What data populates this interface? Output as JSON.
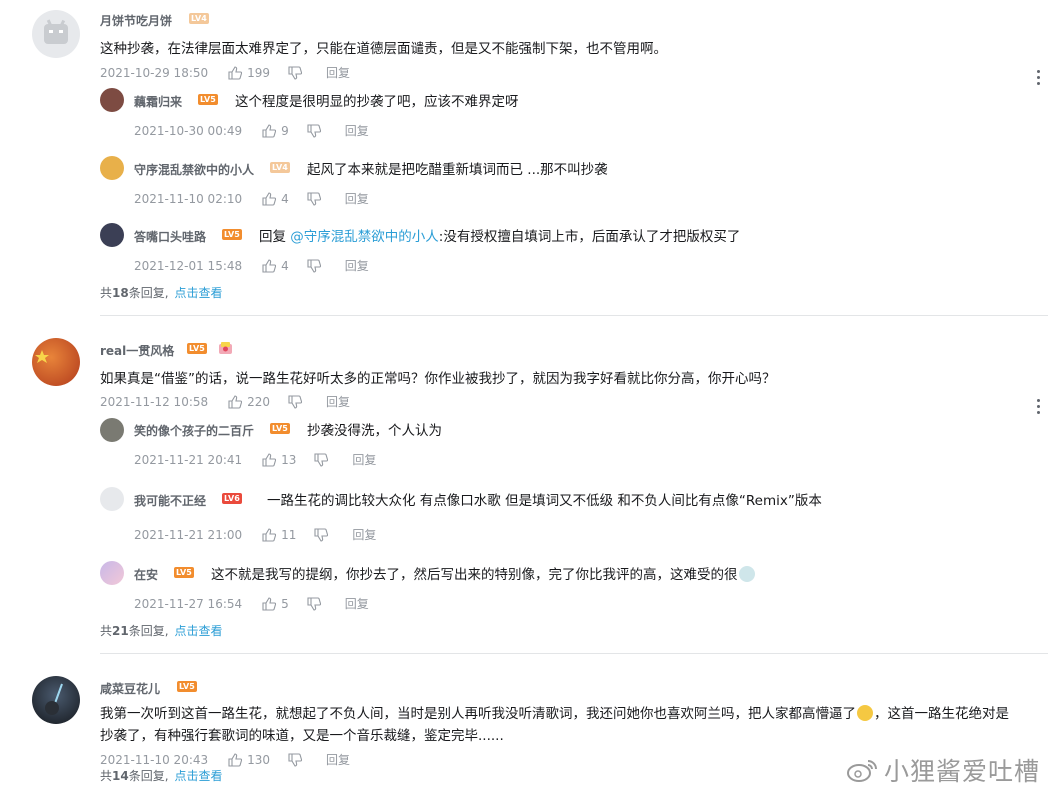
{
  "comments": [
    {
      "user": "月饼节吃月饼",
      "level": "LV4",
      "text": "这种抄袭，在法律层面太难界定了，只能在道德层面谴责，但是又不能强制下架，也不管用啊。",
      "time": "2021-10-29 18:50",
      "likes": "199",
      "reply_label": "回复",
      "replies": [
        {
          "user": "藕霜归来",
          "level": "LV5",
          "text": "这个程度是很明显的抄袭了吧，应该不难界定呀",
          "time": "2021-10-30 00:49",
          "likes": "9",
          "reply_label": "回复"
        },
        {
          "user": "守序混乱禁欲中的小人",
          "level": "LV4",
          "text": "起风了本来就是把吃醋重新填词而已 ...那不叫抄袭",
          "time": "2021-11-10 02:10",
          "likes": "4",
          "reply_label": "回复"
        },
        {
          "user": "答嘴口头哇路",
          "level": "LV5",
          "text_prefix": "回复 ",
          "mention": "@守序混乱禁欲中的小人",
          "text": ":没有授权擅自填词上市，后面承认了才把版权买了",
          "time": "2021-12-01 15:48",
          "likes": "4",
          "reply_label": "回复"
        }
      ],
      "summary_prefix": "共",
      "summary_count": "18",
      "summary_suffix": "条回复,",
      "summary_link": "点击查看"
    },
    {
      "user": "real一贯风格",
      "level": "LV5",
      "text": "如果真是“借鉴”的话，说一路生花好听太多的正常吗？你作业被我抄了，就因为我字好看就比你分高，你开心吗？",
      "time": "2021-11-12 10:58",
      "likes": "220",
      "reply_label": "回复",
      "replies": [
        {
          "user": "笑的像个孩子的二百斤",
          "level": "LV5",
          "text": "抄袭没得洗，个人认为",
          "time": "2021-11-21 20:41",
          "likes": "13",
          "reply_label": "回复"
        },
        {
          "user": "我可能不正经",
          "level": "LV6",
          "text": "一路生花的调比较大众化 有点像口水歌 但是填词又不低级 和不负人间比有点像“Remix”版本",
          "time": "2021-11-21 21:00",
          "likes": "11",
          "reply_label": "回复"
        },
        {
          "user": "在安",
          "level": "LV5",
          "text": "这不就是我写的提纲，你抄去了，然后写出来的特别像，完了你比我评的高，这难受的很",
          "time": "2021-11-27 16:54",
          "likes": "5",
          "reply_label": "回复"
        }
      ],
      "summary_prefix": "共",
      "summary_count": "21",
      "summary_suffix": "条回复,",
      "summary_link": "点击查看"
    },
    {
      "user": "咸菜豆花儿",
      "level": "LV5",
      "text_line1": "我第一次听到这首一路生花，就想起了不负人间，当时是别人再听我没听清歌词，我还问她你也喜欢阿兰吗，把人家都高懵逼了",
      "text_line1_tail": "，这首一路生花绝对是",
      "text_line2": "抄袭了，有种强行套歌词的味道，又是一个音乐裁缝，鉴定完毕......",
      "time": "2021-11-10 20:43",
      "likes": "130",
      "reply_label": "回复",
      "summary_prefix": "共",
      "summary_count": "14",
      "summary_suffix": "条回复,",
      "summary_link": "点击查看"
    }
  ],
  "watermark": "小狸酱爱吐槽",
  "colors": {
    "link": "#2c9ed6",
    "meta": "#9499a0",
    "level": "#f28d2e"
  }
}
